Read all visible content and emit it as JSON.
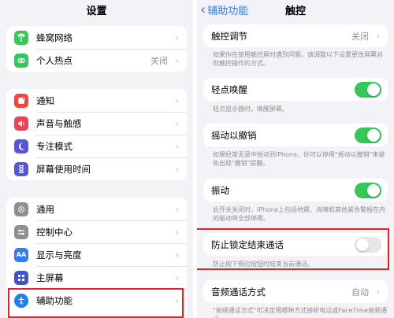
{
  "left": {
    "title": "设置",
    "group1": [
      {
        "label": "蜂窝网络",
        "icon": "antenna-icon",
        "color": "#34c759"
      },
      {
        "label": "个人热点",
        "icon": "link-icon",
        "color": "#34c759",
        "value": "关闭"
      }
    ],
    "group2": [
      {
        "label": "通知",
        "icon": "bell-icon",
        "color": "#f2453d"
      },
      {
        "label": "声音与触感",
        "icon": "speaker-icon",
        "color": "#f0405a"
      },
      {
        "label": "专注模式",
        "icon": "moon-icon",
        "color": "#5856d6"
      },
      {
        "label": "屏幕使用时间",
        "icon": "hourglass-icon",
        "color": "#5856d6"
      }
    ],
    "group3": [
      {
        "label": "通用",
        "icon": "gear-icon",
        "color": "#8e8e93"
      },
      {
        "label": "控制中心",
        "icon": "sliders-icon",
        "color": "#8e8e93"
      },
      {
        "label": "显示与亮度",
        "icon": "aa-icon",
        "color": "#2f7cf6"
      },
      {
        "label": "主屏幕",
        "icon": "grid-icon",
        "color": "#3f51d6"
      },
      {
        "label": "辅助功能",
        "icon": "accessibility-icon",
        "color": "#1a7ff0"
      }
    ]
  },
  "right": {
    "back_label": "辅助功能",
    "title": "触控",
    "touch_adjust": {
      "label": "触控调节",
      "value": "关闭",
      "footer": "如果你在使用触控屏时遇到问题，请调整以下设置更改屏幕对你触控操作的方式。"
    },
    "tap_wake": {
      "label": "轻点唤醒",
      "footer": "轻点显示器时，唤醒屏幕。"
    },
    "shake_undo": {
      "label": "摇动以撤销",
      "footer": "如果经常无意中摇动到iPhone，你可以停用\"摇动以撤销\"来避免出现\"撤销\"提醒。"
    },
    "vibration": {
      "label": "振动",
      "footer": "此开关关闭时，iPhone上包括地震、海啸和其他紧急警报在内的振动将全部停用。"
    },
    "prevent_lock": {
      "label": "防止锁定结束通话",
      "footer": "防止按下侧边按钮时结束当前通话。"
    },
    "audio_routing": {
      "label": "音频通话方式",
      "value": "自动",
      "footer": "\"音频通话方式\"可决定用哪种方式接听电话或FaceTime音频通话。"
    }
  },
  "colors": {
    "toggle_on": "#34c759",
    "toggle_off": "#e5e5ea",
    "highlight": "#e0252a",
    "accent": "#2f7cf6"
  }
}
